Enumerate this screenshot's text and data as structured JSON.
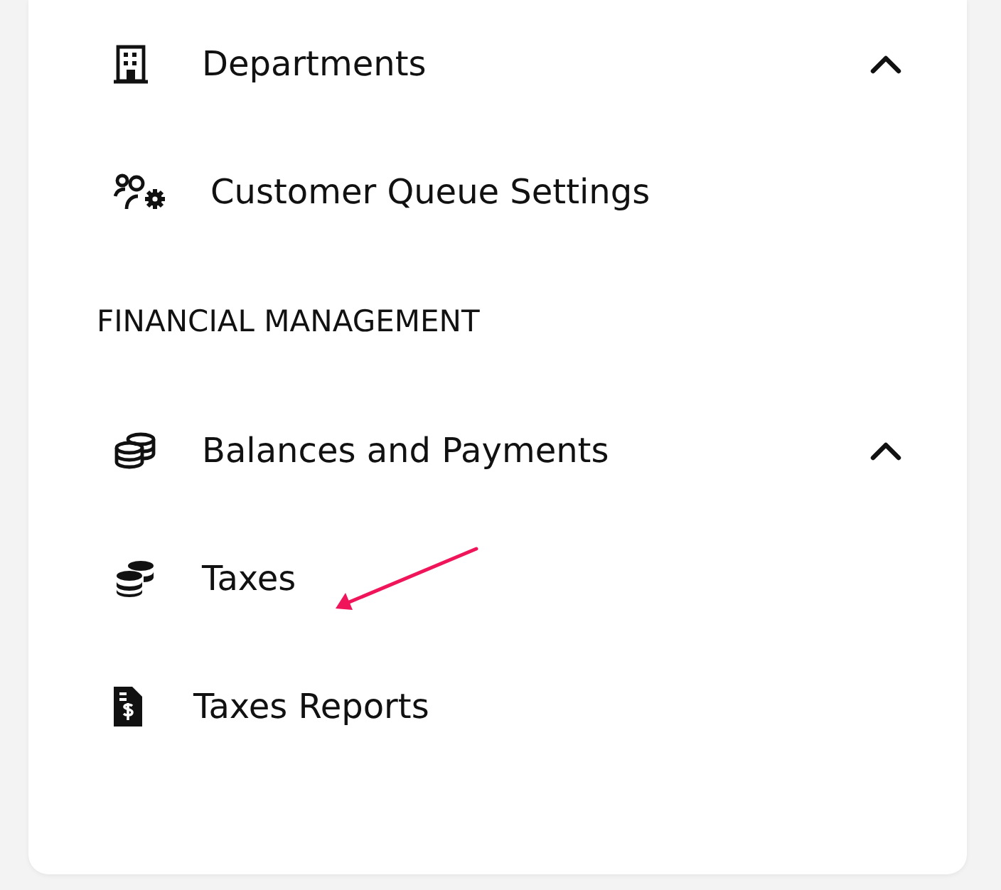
{
  "menu": [
    {
      "kind": "item",
      "label": "Departments",
      "expanded": true
    },
    {
      "kind": "item",
      "label": "Customer Queue Settings"
    },
    {
      "kind": "section",
      "label": "FINANCIAL MANAGEMENT"
    },
    {
      "kind": "item",
      "label": "Balances and Payments",
      "expanded": true
    },
    {
      "kind": "item",
      "label": "Taxes"
    },
    {
      "kind": "item",
      "label": "Taxes Reports"
    }
  ]
}
